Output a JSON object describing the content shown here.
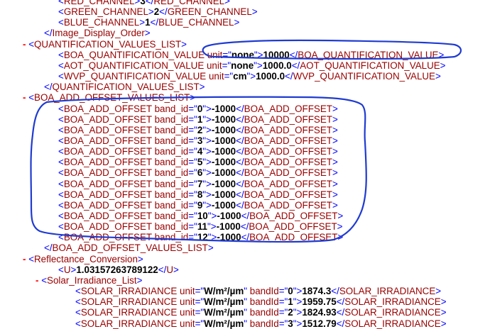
{
  "lines": [
    {
      "indent": 3,
      "marker": "",
      "html": "<span class='b'>&lt;</span><span class='t'>RED_CHANNEL</span><span class='b'>&gt;</span><span class='v'>3</span><span class='b'>&lt;/</span><span class='t'>RED_CHANNEL</span><span class='b'>&gt;</span>"
    },
    {
      "indent": 3,
      "marker": "",
      "html": "<span class='b'>&lt;</span><span class='t'>GREEN_CHANNEL</span><span class='b'>&gt;</span><span class='v'>2</span><span class='b'>&lt;/</span><span class='t'>GREEN_CHANNEL</span><span class='b'>&gt;</span>"
    },
    {
      "indent": 3,
      "marker": "",
      "html": "<span class='b'>&lt;</span><span class='t'>BLUE_CHANNEL</span><span class='b'>&gt;</span><span class='v'>1</span><span class='b'>&lt;/</span><span class='t'>BLUE_CHANNEL</span><span class='b'>&gt;</span>"
    },
    {
      "indent": 2,
      "marker": "",
      "html": "<span class='b'>&lt;/</span><span class='t'>Image_Display_Order</span><span class='b'>&gt;</span>"
    },
    {
      "indent": 1,
      "marker": "-",
      "html": "<span class='b'>&lt;</span><span class='t'>QUANTIFICATION_VALUES_LIST</span><span class='b'>&gt;</span>"
    },
    {
      "indent": 3,
      "marker": "",
      "html": "<span class='b'>&lt;</span><span class='t'>BOA_QUANTIFICATION_VALUE</span> <span class='t'>unit</span><span class='b'>=\"</span><span class='v'>none</span><span class='b'>\"&gt;</span><span class='v'>10000</span><span class='b'>&lt;/</span><span class='t'>BOA_QUANTIFICATION_VALUE</span><span class='b'>&gt;</span>"
    },
    {
      "indent": 3,
      "marker": "",
      "html": "<span class='b'>&lt;</span><span class='t'>AOT_QUANTIFICATION_VALUE</span> <span class='t'>unit</span><span class='b'>=\"</span><span class='v'>none</span><span class='b'>\"&gt;</span><span class='v'>1000.0</span><span class='b'>&lt;/</span><span class='t'>AOT_QUANTIFICATION_VALUE</span><span class='b'>&gt;</span>"
    },
    {
      "indent": 3,
      "marker": "",
      "html": "<span class='b'>&lt;</span><span class='t'>WVP_QUANTIFICATION_VALUE</span> <span class='t'>unit</span><span class='b'>=\"</span><span class='v'>cm</span><span class='b'>\"&gt;</span><span class='v'>1000.0</span><span class='b'>&lt;/</span><span class='t'>WVP_QUANTIFICATION_VALUE</span><span class='b'>&gt;</span>"
    },
    {
      "indent": 2,
      "marker": "",
      "html": "<span class='b'>&lt;/</span><span class='t'>QUANTIFICATION_VALUES_LIST</span><span class='b'>&gt;</span>"
    },
    {
      "indent": 1,
      "marker": "-",
      "html": "<span class='b'>&lt;</span><span class='t'>BOA_ADD_OFFSET_VALUES_LIST</span><span class='b'>&gt;</span>"
    },
    {
      "indent": 3,
      "marker": "",
      "html": "<span class='b'>&lt;</span><span class='t'>BOA_ADD_OFFSET</span> <span class='t'>band_id</span><span class='b'>=\"</span><span class='v'>0</span><span class='b'>\"&gt;</span><span class='v'>-1000</span><span class='b'>&lt;/</span><span class='t'>BOA_ADD_OFFSET</span><span class='b'>&gt;</span>"
    },
    {
      "indent": 3,
      "marker": "",
      "html": "<span class='b'>&lt;</span><span class='t'>BOA_ADD_OFFSET</span> <span class='t'>band_id</span><span class='b'>=\"</span><span class='v'>1</span><span class='b'>\"&gt;</span><span class='v'>-1000</span><span class='b'>&lt;/</span><span class='t'>BOA_ADD_OFFSET</span><span class='b'>&gt;</span>"
    },
    {
      "indent": 3,
      "marker": "",
      "html": "<span class='b'>&lt;</span><span class='t'>BOA_ADD_OFFSET</span> <span class='t'>band_id</span><span class='b'>=\"</span><span class='v'>2</span><span class='b'>\"&gt;</span><span class='v'>-1000</span><span class='b'>&lt;/</span><span class='t'>BOA_ADD_OFFSET</span><span class='b'>&gt;</span>"
    },
    {
      "indent": 3,
      "marker": "",
      "html": "<span class='b'>&lt;</span><span class='t'>BOA_ADD_OFFSET</span> <span class='t'>band_id</span><span class='b'>=\"</span><span class='v'>3</span><span class='b'>\"&gt;</span><span class='v'>-1000</span><span class='b'>&lt;/</span><span class='t'>BOA_ADD_OFFSET</span><span class='b'>&gt;</span>"
    },
    {
      "indent": 3,
      "marker": "",
      "html": "<span class='b'>&lt;</span><span class='t'>BOA_ADD_OFFSET</span> <span class='t'>band_id</span><span class='b'>=\"</span><span class='v'>4</span><span class='b'>\"&gt;</span><span class='v'>-1000</span><span class='b'>&lt;/</span><span class='t'>BOA_ADD_OFFSET</span><span class='b'>&gt;</span>"
    },
    {
      "indent": 3,
      "marker": "",
      "html": "<span class='b'>&lt;</span><span class='t'>BOA_ADD_OFFSET</span> <span class='t'>band_id</span><span class='b'>=\"</span><span class='v'>5</span><span class='b'>\"&gt;</span><span class='v'>-1000</span><span class='b'>&lt;/</span><span class='t'>BOA_ADD_OFFSET</span><span class='b'>&gt;</span>"
    },
    {
      "indent": 3,
      "marker": "",
      "html": "<span class='b'>&lt;</span><span class='t'>BOA_ADD_OFFSET</span> <span class='t'>band_id</span><span class='b'>=\"</span><span class='v'>6</span><span class='b'>\"&gt;</span><span class='v'>-1000</span><span class='b'>&lt;/</span><span class='t'>BOA_ADD_OFFSET</span><span class='b'>&gt;</span>"
    },
    {
      "indent": 3,
      "marker": "",
      "html": "<span class='b'>&lt;</span><span class='t'>BOA_ADD_OFFSET</span> <span class='t'>band_id</span><span class='b'>=\"</span><span class='v'>7</span><span class='b'>\"&gt;</span><span class='v'>-1000</span><span class='b'>&lt;/</span><span class='t'>BOA_ADD_OFFSET</span><span class='b'>&gt;</span>"
    },
    {
      "indent": 3,
      "marker": "",
      "html": "<span class='b'>&lt;</span><span class='t'>BOA_ADD_OFFSET</span> <span class='t'>band_id</span><span class='b'>=\"</span><span class='v'>8</span><span class='b'>\"&gt;</span><span class='v'>-1000</span><span class='b'>&lt;/</span><span class='t'>BOA_ADD_OFFSET</span><span class='b'>&gt;</span>"
    },
    {
      "indent": 3,
      "marker": "",
      "html": "<span class='b'>&lt;</span><span class='t'>BOA_ADD_OFFSET</span> <span class='t'>band_id</span><span class='b'>=\"</span><span class='v'>9</span><span class='b'>\"&gt;</span><span class='v'>-1000</span><span class='b'>&lt;/</span><span class='t'>BOA_ADD_OFFSET</span><span class='b'>&gt;</span>"
    },
    {
      "indent": 3,
      "marker": "",
      "html": "<span class='b'>&lt;</span><span class='t'>BOA_ADD_OFFSET</span> <span class='t'>band_id</span><span class='b'>=\"</span><span class='v'>10</span><span class='b'>\"&gt;</span><span class='v'>-1000</span><span class='b'>&lt;/</span><span class='t'>BOA_ADD_OFFSET</span><span class='b'>&gt;</span>"
    },
    {
      "indent": 3,
      "marker": "",
      "html": "<span class='b'>&lt;</span><span class='t'>BOA_ADD_OFFSET</span> <span class='t'>band_id</span><span class='b'>=\"</span><span class='v'>11</span><span class='b'>\"&gt;</span><span class='v'>-1000</span><span class='b'>&lt;/</span><span class='t'>BOA_ADD_OFFSET</span><span class='b'>&gt;</span>"
    },
    {
      "indent": 3,
      "marker": "",
      "html": "<span class='b'>&lt;</span><span class='t'>BOA_ADD_OFFSET</span> <span class='t'>band_id</span><span class='b'>=\"</span><span class='v'>12</span><span class='b'>\"&gt;</span><span class='v'>-1000</span><span class='b'>&lt;/</span><span class='t'>BOA_ADD_OFFSET</span><span class='b'>&gt;</span>"
    },
    {
      "indent": 2,
      "marker": "",
      "html": "<span class='b'>&lt;/</span><span class='t'>BOA_ADD_OFFSET_VALUES_LIST</span><span class='b'>&gt;</span>"
    },
    {
      "indent": 1,
      "marker": "-",
      "html": "<span class='b'>&lt;</span><span class='t'>Reflectance_Conversion</span><span class='b'>&gt;</span>"
    },
    {
      "indent": 3,
      "marker": "",
      "html": "<span class='b'>&lt;</span><span class='t'>U</span><span class='b'>&gt;</span><span class='v'>1.03157263789122</span><span class='b'>&lt;/</span><span class='t'>U</span><span class='b'>&gt;</span>"
    },
    {
      "indent": 2,
      "marker": "-",
      "html": "<span class='b'>&lt;</span><span class='t'>Solar_Irradiance_List</span><span class='b'>&gt;</span>"
    },
    {
      "indent": 4,
      "marker": "",
      "html": "<span class='b'>&lt;</span><span class='t'>SOLAR_IRRADIANCE</span> <span class='t'>unit</span><span class='b'>=\"</span><span class='v'>W/m²/µm</span><span class='b'>\"</span> <span class='t'>bandId</span><span class='b'>=\"</span><span class='v'>0</span><span class='b'>\"&gt;</span><span class='v'>1874.3</span><span class='b'>&lt;/</span><span class='t'>SOLAR_IRRADIANCE</span><span class='b'>&gt;</span>"
    },
    {
      "indent": 4,
      "marker": "",
      "html": "<span class='b'>&lt;</span><span class='t'>SOLAR_IRRADIANCE</span> <span class='t'>unit</span><span class='b'>=\"</span><span class='v'>W/m²/µm</span><span class='b'>\"</span> <span class='t'>bandId</span><span class='b'>=\"</span><span class='v'>1</span><span class='b'>\"&gt;</span><span class='v'>1959.75</span><span class='b'>&lt;/</span><span class='t'>SOLAR_IRRADIANCE</span><span class='b'>&gt;</span>"
    },
    {
      "indent": 4,
      "marker": "",
      "html": "<span class='b'>&lt;</span><span class='t'>SOLAR_IRRADIANCE</span> <span class='t'>unit</span><span class='b'>=\"</span><span class='v'>W/m²/µm</span><span class='b'>\"</span> <span class='t'>bandId</span><span class='b'>=\"</span><span class='v'>2</span><span class='b'>\"&gt;</span><span class='v'>1824.93</span><span class='b'>&lt;/</span><span class='t'>SOLAR_IRRADIANCE</span><span class='b'>&gt;</span>"
    },
    {
      "indent": 4,
      "marker": "",
      "html": "<span class='b'>&lt;</span><span class='t'>SOLAR_IRRADIANCE</span> <span class='t'>unit</span><span class='b'>=\"</span><span class='v'>W/m²/µm</span><span class='b'>\"</span> <span class='t'>bandId</span><span class='b'>=\"</span><span class='v'>3</span><span class='b'>\"&gt;</span><span class='v'>1512.79</span><span class='b'>&lt;/</span><span class='t'>SOLAR_IRRADIANCE</span><span class='b'>&gt;</span>"
    }
  ],
  "colors": {
    "tag_bracket": "#0000ff",
    "tag_name": "#990000",
    "value": "#000000",
    "collapse_marker": "#ff0000",
    "annotation_ink": "#1f3bd1"
  }
}
